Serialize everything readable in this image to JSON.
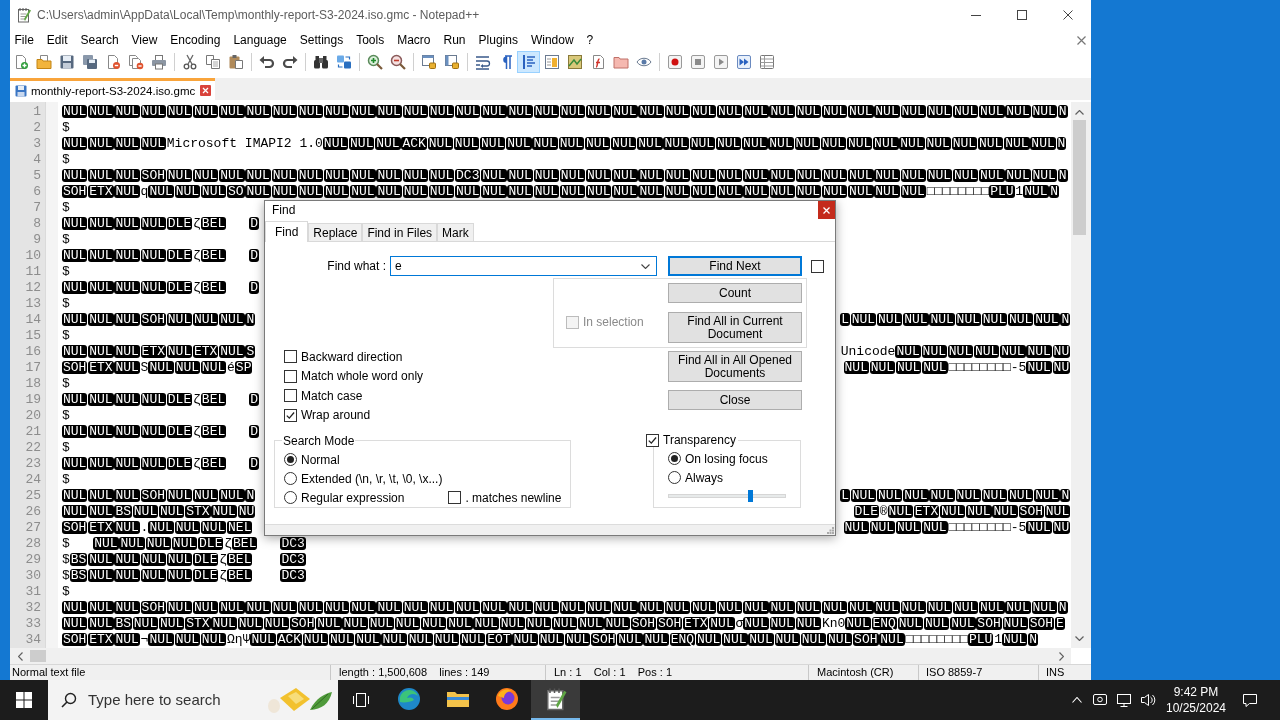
{
  "window": {
    "title": "C:\\Users\\admin\\AppData\\Local\\Temp\\monthly-report-S3-2024.iso.gmc - Notepad++"
  },
  "menu": [
    "File",
    "Edit",
    "Search",
    "View",
    "Encoding",
    "Language",
    "Settings",
    "Tools",
    "Macro",
    "Run",
    "Plugins",
    "Window",
    "?"
  ],
  "toolbar": [
    {
      "on": false
    },
    {
      "on": false
    },
    {
      "on": false
    },
    {
      "on": false
    },
    {
      "on": false
    },
    {
      "on": false
    },
    {
      "on": false
    },
    {
      "on": false
    },
    {
      "on": false
    },
    {
      "on": false
    },
    {
      "on": false
    },
    {
      "on": false
    },
    {
      "on": false
    },
    {
      "on": false
    },
    {
      "on": false
    },
    {
      "on": false
    },
    {
      "on": false
    },
    {
      "on": false
    },
    {
      "on": false
    },
    {
      "on": false
    },
    {
      "on": true
    },
    {
      "on": false
    },
    {
      "on": false
    },
    {
      "on": false
    },
    {
      "on": false
    },
    {
      "on": false
    },
    {
      "on": false
    },
    {
      "on": false
    },
    {
      "on": false
    },
    {
      "on": false
    },
    {
      "on": false
    }
  ],
  "tabs": [
    {
      "label": "monthly-report-S3-2024.iso.gmc",
      "selected": true
    }
  ],
  "editor": {
    "lines": [
      {
        "number": "1",
        "parts": [
          [
            {
              "kind": "ctrl",
              "codes": [
                "NUL",
                "NUL",
                "NUL",
                "NUL",
                "NUL",
                "NUL",
                "NUL",
                "NUL",
                "NUL",
                "NUL",
                "NUL",
                "NUL",
                "NUL",
                "NUL",
                "NUL",
                "NUL",
                "NUL",
                "NUL",
                "NUL",
                "NUL",
                "NUL",
                "NUL",
                "NUL",
                "NUL",
                "NUL",
                "NUL",
                "NUL",
                "NUL",
                "NUL",
                "NUL",
                "NUL",
                "NUL",
                "NUL",
                "NUL",
                "NUL",
                "NUL",
                "NUL",
                "NUL",
                "N"
              ]
            }
          ]
        ]
      },
      {
        "number": "2",
        "parts": [
          [
            {
              "kind": "text",
              "text": "$"
            }
          ]
        ]
      },
      {
        "number": "3",
        "parts": [
          [
            {
              "kind": "ctrl",
              "codes": [
                "NUL",
                "NUL",
                "NUL",
                "NUL"
              ]
            },
            {
              "kind": "text",
              "text": "Microsoft IMAPI2 1.0"
            },
            {
              "kind": "ctrl",
              "codes": [
                "NUL",
                "NUL",
                "NUL",
                "ACK",
                "NUL",
                "NUL",
                "NUL",
                "NUL",
                "NUL",
                "NUL",
                "NUL",
                "NUL",
                "NUL",
                "NUL",
                "NUL",
                "NUL",
                "NUL",
                "NUL",
                "NUL",
                "NUL",
                "NUL",
                "NUL",
                "NUL",
                "NUL",
                "NUL",
                "NUL",
                "NUL",
                "NUL",
                "N"
              ]
            }
          ]
        ]
      },
      {
        "number": "4",
        "parts": [
          [
            {
              "kind": "text",
              "text": "$"
            }
          ]
        ]
      },
      {
        "number": "5",
        "parts": [
          [
            {
              "kind": "ctrl",
              "codes": [
                "NUL",
                "NUL",
                "NUL",
                "SOH",
                "NUL",
                "NUL",
                "NUL",
                "NUL",
                "NUL",
                "NUL",
                "NUL",
                "NUL",
                "NUL",
                "NUL",
                "NUL",
                "DC3",
                "NUL",
                "NUL",
                "NUL",
                "NUL",
                "NUL",
                "NUL",
                "NUL",
                "NUL",
                "NUL",
                "NUL",
                "NUL",
                "NUL",
                "NUL",
                "NUL",
                "NUL",
                "NUL",
                "NUL",
                "NUL",
                "NUL",
                "NUL",
                "NUL",
                "NUL",
                "N"
              ]
            }
          ]
        ]
      },
      {
        "number": "6",
        "parts": [
          [
            {
              "kind": "ctrl",
              "codes": [
                "SOH",
                "ETX",
                "NUL"
              ]
            },
            {
              "kind": "text",
              "text": "q"
            },
            {
              "kind": "ctrl",
              "codes": [
                "NUL",
                "NUL",
                "NUL",
                "SO",
                "NUL",
                "NUL",
                "NUL",
                "NUL",
                "NUL",
                "NUL",
                "NUL",
                "NUL",
                "NUL",
                "NUL",
                "NUL",
                "NUL",
                "NUL",
                "NUL",
                "NUL",
                "NUL",
                "NUL",
                "NUL",
                "NUL",
                "NUL",
                "NUL",
                "NUL",
                "NUL",
                "NUL",
                "NUL",
                "NUL"
              ]
            },
            {
              "kind": "text",
              "text": "□□□□□□□□"
            },
            {
              "kind": "ctrl",
              "codes": [
                "PLU"
              ]
            },
            {
              "kind": "text",
              "text": "1"
            },
            {
              "kind": "ctrl",
              "codes": [
                "NUL",
                "N"
              ]
            }
          ]
        ]
      },
      {
        "number": "7",
        "parts": [
          [
            {
              "kind": "text",
              "text": "$"
            }
          ]
        ]
      },
      {
        "number": "8",
        "parts": [
          [
            {
              "kind": "ctrl",
              "codes": [
                "NUL",
                "NUL",
                "NUL",
                "NUL",
                "DLE"
              ]
            },
            {
              "kind": "text",
              "text": "ζ"
            },
            {
              "kind": "ctrl",
              "codes": [
                "BEL"
              ]
            },
            {
              "kind": "tab"
            },
            {
              "kind": "ctrl",
              "codes": [
                "D"
              ]
            }
          ]
        ]
      },
      {
        "number": "9",
        "parts": [
          [
            {
              "kind": "text",
              "text": "$"
            }
          ]
        ]
      },
      {
        "number": "10",
        "parts": [
          [
            {
              "kind": "ctrl",
              "codes": [
                "NUL",
                "NUL",
                "NUL",
                "NUL",
                "DLE"
              ]
            },
            {
              "kind": "text",
              "text": "ζ"
            },
            {
              "kind": "ctrl",
              "codes": [
                "BEL"
              ]
            },
            {
              "kind": "tab"
            },
            {
              "kind": "ctrl",
              "codes": [
                "D"
              ]
            }
          ]
        ]
      },
      {
        "number": "11",
        "parts": [
          [
            {
              "kind": "text",
              "text": "$"
            }
          ]
        ]
      },
      {
        "number": "12",
        "parts": [
          [
            {
              "kind": "ctrl",
              "codes": [
                "NUL",
                "NUL",
                "NUL",
                "NUL",
                "DLE"
              ]
            },
            {
              "kind": "text",
              "text": "ζ"
            },
            {
              "kind": "ctrl",
              "codes": [
                "BEL"
              ]
            },
            {
              "kind": "tab"
            },
            {
              "kind": "ctrl",
              "codes": [
                "D"
              ]
            }
          ]
        ]
      },
      {
        "number": "13",
        "parts": [
          [
            {
              "kind": "text",
              "text": "$"
            }
          ]
        ]
      },
      {
        "number": "14",
        "parts": [
          [
            {
              "kind": "ctrl",
              "codes": [
                "NUL",
                "NUL",
                "NUL",
                "SOH",
                "NUL",
                "NUL",
                "NUL",
                "N"
              ]
            }
          ],
          [
            {
              "kind": "ctrl",
              "codes": [
                "L",
                "NUL",
                "NUL",
                "NUL",
                "NUL",
                "NUL",
                "NUL",
                "NUL",
                "NUL",
                "N"
              ]
            }
          ]
        ]
      },
      {
        "number": "15",
        "parts": [
          [
            {
              "kind": "text",
              "text": "$"
            }
          ]
        ]
      },
      {
        "number": "16",
        "parts": [
          [
            {
              "kind": "ctrl",
              "codes": [
                "NUL",
                "NUL",
                "NUL",
                "ETX",
                "NUL",
                "ETX",
                "NUL",
                "S"
              ]
            }
          ],
          [
            {
              "kind": "text",
              "text": "Unicode"
            },
            {
              "kind": "ctrl",
              "codes": [
                "NUL",
                "NUL",
                "NUL",
                "NUL",
                "NUL",
                "NUL",
                "NU"
              ]
            }
          ]
        ]
      },
      {
        "number": "17",
        "parts": [
          [
            {
              "kind": "ctrl",
              "codes": [
                "SOH",
                "ETX",
                "NUL"
              ]
            },
            {
              "kind": "text",
              "text": "S"
            },
            {
              "kind": "ctrl",
              "codes": [
                "NUL",
                "NUL",
                "NUL"
              ]
            },
            {
              "kind": "text",
              "text": "é"
            },
            {
              "kind": "ctrl",
              "codes": [
                "SP"
              ]
            }
          ],
          [
            {
              "kind": "ctrl",
              "codes": [
                "NUL",
                "NUL",
                "NUL",
                "NUL"
              ]
            },
            {
              "kind": "text",
              "text": "□□□□□□□□-5"
            },
            {
              "kind": "ctrl",
              "codes": [
                "NUL",
                "NU"
              ]
            }
          ]
        ]
      },
      {
        "number": "18",
        "parts": [
          [
            {
              "kind": "text",
              "text": "$"
            }
          ]
        ]
      },
      {
        "number": "19",
        "parts": [
          [
            {
              "kind": "ctrl",
              "codes": [
                "NUL",
                "NUL",
                "NUL",
                "NUL",
                "DLE"
              ]
            },
            {
              "kind": "text",
              "text": "ζ"
            },
            {
              "kind": "ctrl",
              "codes": [
                "BEL"
              ]
            },
            {
              "kind": "tab"
            },
            {
              "kind": "ctrl",
              "codes": [
                "D"
              ]
            }
          ]
        ]
      },
      {
        "number": "20",
        "parts": [
          [
            {
              "kind": "text",
              "text": "$"
            }
          ]
        ]
      },
      {
        "number": "21",
        "parts": [
          [
            {
              "kind": "ctrl",
              "codes": [
                "NUL",
                "NUL",
                "NUL",
                "NUL",
                "DLE"
              ]
            },
            {
              "kind": "text",
              "text": "ζ"
            },
            {
              "kind": "ctrl",
              "codes": [
                "BEL"
              ]
            },
            {
              "kind": "tab"
            },
            {
              "kind": "ctrl",
              "codes": [
                "D"
              ]
            }
          ]
        ]
      },
      {
        "number": "22",
        "parts": [
          [
            {
              "kind": "text",
              "text": "$"
            }
          ]
        ]
      },
      {
        "number": "23",
        "parts": [
          [
            {
              "kind": "ctrl",
              "codes": [
                "NUL",
                "NUL",
                "NUL",
                "NUL",
                "DLE"
              ]
            },
            {
              "kind": "text",
              "text": "ζ"
            },
            {
              "kind": "ctrl",
              "codes": [
                "BEL"
              ]
            },
            {
              "kind": "tab"
            },
            {
              "kind": "ctrl",
              "codes": [
                "D"
              ]
            }
          ]
        ]
      },
      {
        "number": "24",
        "parts": [
          [
            {
              "kind": "text",
              "text": "$"
            }
          ]
        ]
      },
      {
        "number": "25",
        "parts": [
          [
            {
              "kind": "ctrl",
              "codes": [
                "NUL",
                "NUL",
                "NUL",
                "SOH",
                "NUL",
                "NUL",
                "NUL",
                "N"
              ]
            }
          ],
          [
            {
              "kind": "ctrl",
              "codes": [
                "L",
                "NUL",
                "NUL",
                "NUL",
                "NUL",
                "NUL",
                "NUL",
                "NUL",
                "NUL",
                "N"
              ]
            }
          ]
        ]
      },
      {
        "number": "26",
        "parts": [
          [
            {
              "kind": "ctrl",
              "codes": [
                "NUL",
                "NUL",
                "BS",
                "NUL",
                "NUL",
                "STX",
                "NUL",
                "NU"
              ]
            }
          ],
          [
            {
              "kind": "ctrl",
              "codes": [
                "DLE"
              ]
            },
            {
              "kind": "text",
              "text": "®"
            },
            {
              "kind": "ctrl",
              "codes": [
                "NUL",
                "ETX",
                "NUL",
                "NUL",
                "NUL",
                "SOH",
                "NUL"
              ]
            }
          ]
        ]
      },
      {
        "number": "27",
        "parts": [
          [
            {
              "kind": "ctrl",
              "codes": [
                "SOH",
                "ETX",
                "NUL"
              ]
            },
            {
              "kind": "text",
              "text": "."
            },
            {
              "kind": "ctrl",
              "codes": [
                "NUL",
                "NUL",
                "NUL",
                "NEL"
              ]
            }
          ],
          [
            {
              "kind": "ctrl",
              "codes": [
                "NUL",
                "NUL",
                "NUL",
                "NUL"
              ]
            },
            {
              "kind": "text",
              "text": "□□□□□□□□-5"
            },
            {
              "kind": "ctrl",
              "codes": [
                "NUL",
                "NU"
              ]
            }
          ]
        ]
      },
      {
        "number": "28",
        "parts": [
          [
            {
              "kind": "text",
              "text": "$"
            },
            {
              "kind": "tab"
            },
            {
              "kind": "ctrl",
              "codes": [
                "NUL",
                "NUL",
                "NUL",
                "NUL",
                "DLE"
              ]
            },
            {
              "kind": "text",
              "text": "ζ"
            },
            {
              "kind": "ctrl",
              "codes": [
                "BEL"
              ]
            },
            {
              "kind": "tab"
            },
            {
              "kind": "ctrl",
              "codes": [
                "DC3"
              ]
            }
          ]
        ]
      },
      {
        "number": "29",
        "parts": [
          [
            {
              "kind": "text",
              "text": "$"
            },
            {
              "kind": "ctrl",
              "codes": [
                "BS",
                "NUL",
                "NUL",
                "NUL",
                "NUL",
                "DLE"
              ]
            },
            {
              "kind": "text",
              "text": "ζ"
            },
            {
              "kind": "ctrl",
              "codes": [
                "BEL"
              ]
            },
            {
              "kind": "tab"
            },
            {
              "kind": "ctrl",
              "codes": [
                "DC3"
              ]
            }
          ]
        ]
      },
      {
        "number": "30",
        "parts": [
          [
            {
              "kind": "text",
              "text": "$"
            },
            {
              "kind": "ctrl",
              "codes": [
                "BS",
                "NUL",
                "NUL",
                "NUL",
                "NUL",
                "DLE"
              ]
            },
            {
              "kind": "text",
              "text": "ζ"
            },
            {
              "kind": "ctrl",
              "codes": [
                "BEL"
              ]
            },
            {
              "kind": "tab"
            },
            {
              "kind": "ctrl",
              "codes": [
                "DC3"
              ]
            }
          ]
        ]
      },
      {
        "number": "31",
        "parts": [
          [
            {
              "kind": "text",
              "text": "$"
            }
          ]
        ]
      },
      {
        "number": "32",
        "parts": [
          [
            {
              "kind": "ctrl",
              "codes": [
                "NUL",
                "NUL",
                "NUL",
                "SOH",
                "NUL",
                "NUL",
                "NUL",
                "NUL",
                "NUL",
                "NUL",
                "NUL",
                "NUL",
                "NUL",
                "NUL",
                "NUL",
                "NUL",
                "NUL",
                "NUL",
                "NUL",
                "NUL",
                "NUL",
                "NUL",
                "NUL",
                "NUL",
                "NUL",
                "NUL",
                "NUL",
                "NUL",
                "NUL",
                "NUL",
                "NUL",
                "NUL",
                "NUL",
                "NUL",
                "NUL",
                "NUL",
                "NUL",
                "NUL",
                "N"
              ]
            }
          ]
        ]
      },
      {
        "number": "33",
        "parts": [
          [
            {
              "kind": "ctrl",
              "codes": [
                "NUL",
                "NUL",
                "BS",
                "NUL",
                "NUL",
                "STX",
                "NUL",
                "NUL",
                "NUL",
                "SOH",
                "NUL",
                "NUL",
                "NUL",
                "NUL",
                "NUL",
                "NUL",
                "NUL",
                "NUL",
                "NUL",
                "NUL",
                "NUL",
                "NUL",
                "SOH",
                "SOH",
                "ETX",
                "NUL"
              ]
            },
            {
              "kind": "text",
              "text": "σ"
            },
            {
              "kind": "ctrl",
              "codes": [
                "NUL",
                "NUL",
                "NUL"
              ]
            },
            {
              "kind": "text",
              "text": "Kn0"
            },
            {
              "kind": "ctrl",
              "codes": [
                "NUL",
                "ENQ",
                "NUL",
                "NUL",
                "NUL",
                "SOH",
                "NUL",
                "SOH",
                "E"
              ]
            }
          ]
        ]
      },
      {
        "number": "34",
        "parts": [
          [
            {
              "kind": "ctrl",
              "codes": [
                "SOH",
                "ETX",
                "NUL"
              ]
            },
            {
              "kind": "text",
              "text": "¬"
            },
            {
              "kind": "ctrl",
              "codes": [
                "NUL",
                "NUL",
                "NUL"
              ]
            },
            {
              "kind": "text",
              "text": "ΩηΨ"
            },
            {
              "kind": "ctrl",
              "codes": [
                "NUL",
                "ACK",
                "NUL",
                "NUL",
                "NUL",
                "NUL",
                "NUL",
                "NUL",
                "NUL",
                "EOT",
                "NUL",
                "NUL",
                "NUL",
                "SOH",
                "NUL",
                "NUL",
                "ENQ",
                "NUL",
                "NUL",
                "NUL",
                "NUL",
                "NUL",
                "NUL",
                "SOH",
                "NUL"
              ]
            },
            {
              "kind": "text",
              "text": "□□□□□□□□"
            },
            {
              "kind": "ctrl",
              "codes": [
                "PLU"
              ]
            },
            {
              "kind": "text",
              "text": "1"
            },
            {
              "kind": "ctrl",
              "codes": [
                "NUL",
                "N"
              ]
            }
          ]
        ]
      }
    ]
  },
  "status_bar": [
    "Normal text file",
    "length : 1,500,608    lines : 149",
    "Ln : 1    Col : 1    Pos : 1",
    "Macintosh (CR)",
    "ISO 8859-7",
    "INS"
  ],
  "find_dialog": {
    "title": "Find",
    "tabs": [
      {
        "label": "Find",
        "selected": true
      },
      {
        "label": "Replace",
        "selected": false
      },
      {
        "label": "Find in Files",
        "selected": false
      },
      {
        "label": "Mark",
        "selected": false
      }
    ],
    "find_what": {
      "label": "Find what :",
      "value": "e"
    },
    "unlabeled_checkbox": {
      "checked": false
    },
    "buttons": [
      {
        "label": "Find Next",
        "default": true
      },
      {
        "label": "Count",
        "default": false
      },
      {
        "label": "Find All in Current Document",
        "default": false
      },
      {
        "label": "Find All in All Opened Documents",
        "default": false
      },
      {
        "label": "Close",
        "default": false
      }
    ],
    "in_selection": {
      "label": "In selection",
      "checked": false,
      "disabled": true
    },
    "options": [
      {
        "label": "Backward direction",
        "checked": false
      },
      {
        "label": "Match whole word only",
        "checked": false
      },
      {
        "label": "Match case",
        "checked": false
      },
      {
        "label": "Wrap around",
        "checked": true
      }
    ],
    "search_mode": {
      "title": "Search Mode",
      "modes": [
        {
          "label": "Normal",
          "selected": true
        },
        {
          "label": "Extended (\\n, \\r, \\t, \\0, \\x...)",
          "selected": false
        },
        {
          "label": "Regular expression",
          "selected": false
        }
      ],
      "dot_matches_newline": {
        "label": ". matches newline",
        "checked": false
      }
    },
    "transparency": {
      "label": "Transparency",
      "checked": true,
      "modes": [
        {
          "label": "On losing focus",
          "selected": true
        },
        {
          "label": "Always",
          "selected": false
        }
      ],
      "level": 0.7
    }
  },
  "taskbar": {
    "search": {
      "placeholder": "Type here to search"
    },
    "apps": [
      {
        "selected": false
      },
      {
        "selected": false
      },
      {
        "selected": false
      },
      {
        "selected": true
      }
    ],
    "clock": {
      "time": "9:42 PM",
      "date": "10/25/2024"
    }
  }
}
